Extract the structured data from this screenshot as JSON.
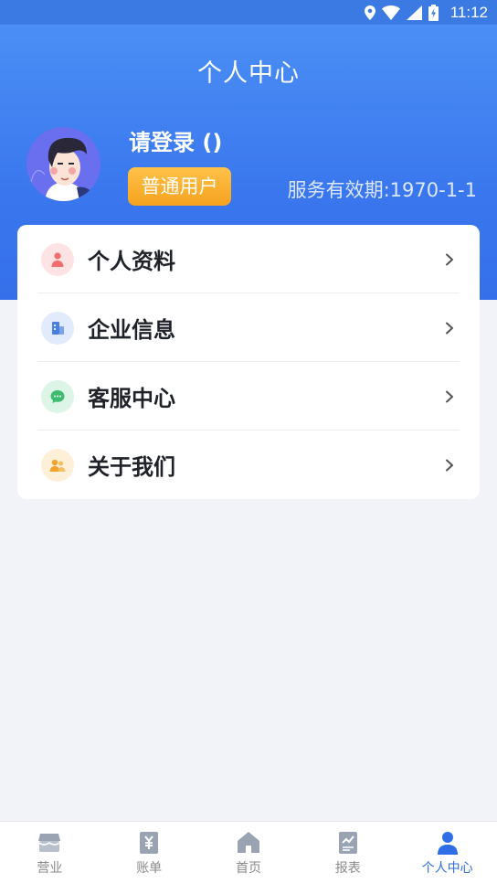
{
  "status_bar": {
    "time": "11:12"
  },
  "header": {
    "title": "个人中心"
  },
  "profile": {
    "username": "请登录 ()",
    "badge": "普通用户",
    "validity": "服务有效期:1970-1-1"
  },
  "menu": {
    "items": [
      {
        "label": "个人资料",
        "icon": "person-icon",
        "icon_bg": "#fde3e3",
        "icon_color": "#f26d6d"
      },
      {
        "label": "企业信息",
        "icon": "building-icon",
        "icon_bg": "#e2ebfb",
        "icon_color": "#4a7fe0"
      },
      {
        "label": "客服中心",
        "icon": "chat-icon",
        "icon_bg": "#dcf5e6",
        "icon_color": "#3dbb6e"
      },
      {
        "label": "关于我们",
        "icon": "team-icon",
        "icon_bg": "#fdefd8",
        "icon_color": "#f3a22c"
      }
    ]
  },
  "tabbar": {
    "items": [
      {
        "label": "营业",
        "icon": "store-icon"
      },
      {
        "label": "账单",
        "icon": "bill-yen-icon"
      },
      {
        "label": "首页",
        "icon": "home-icon"
      },
      {
        "label": "报表",
        "icon": "report-icon"
      },
      {
        "label": "个人中心",
        "icon": "user-icon",
        "active": true
      }
    ]
  },
  "colors": {
    "accent": "#2f6ee6",
    "header_gradient_top": "#4b8ff5",
    "header_gradient_bottom": "#3570ea",
    "badge": "#f6a21e",
    "page_bg": "#f1f3f8"
  }
}
